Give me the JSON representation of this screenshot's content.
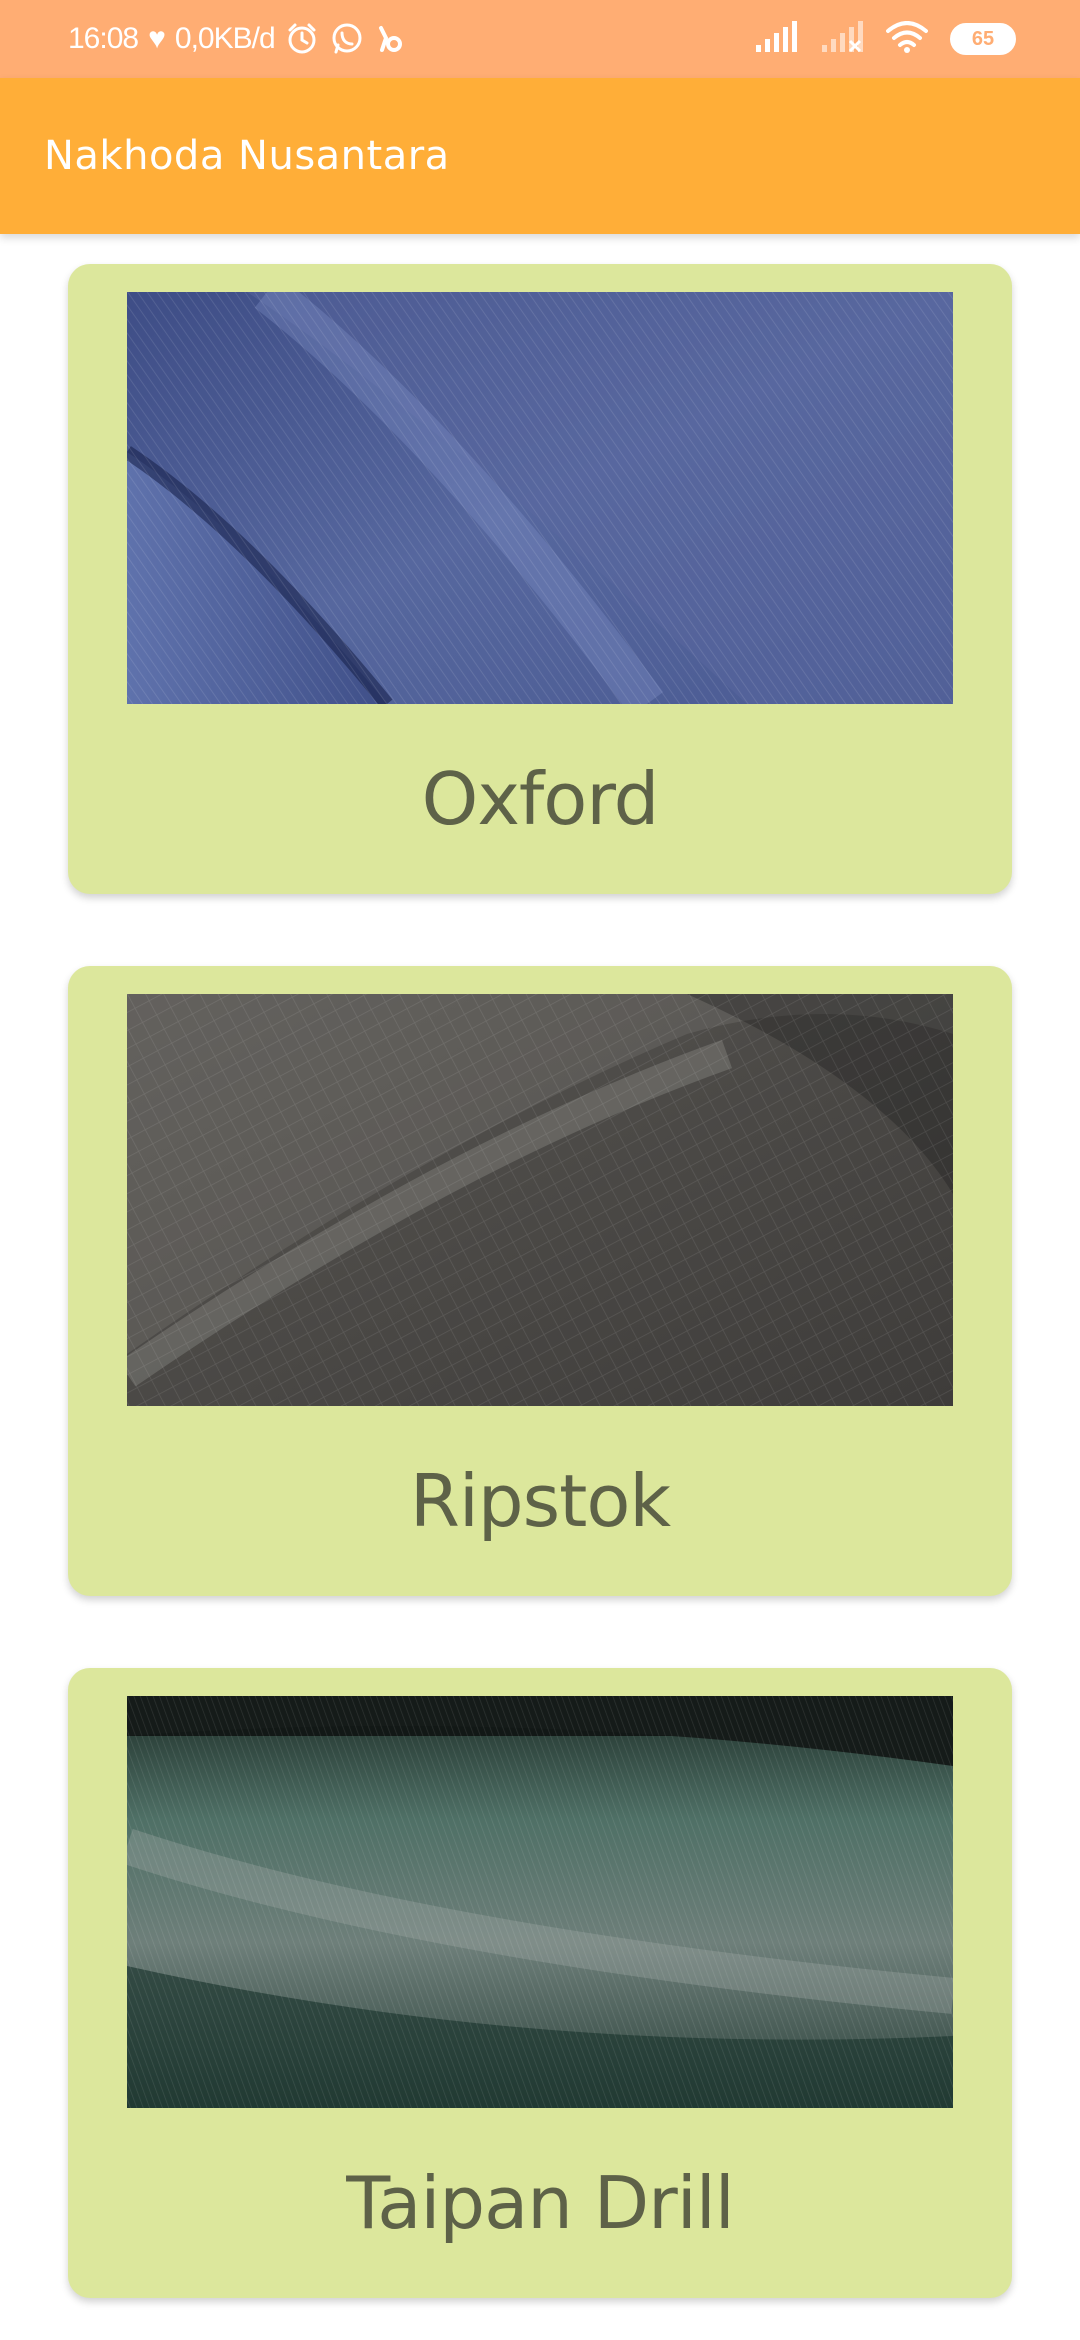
{
  "status_bar": {
    "time": "16:08",
    "heart": "♥",
    "speed": "0,0KB/d",
    "battery": "65",
    "background": "#FFAD73"
  },
  "app_bar": {
    "title": "Nakhoda Nusantara",
    "background": "#FFAE38"
  },
  "fabrics": [
    {
      "name": "Oxford",
      "image": "blue-twill-fabric-photo",
      "swatch": "#4A5A92"
    },
    {
      "name": "Ripstok",
      "image": "dark-grey-ripstop-fabric-photo",
      "swatch": "#4A4845"
    },
    {
      "name": "Taipan Drill",
      "image": "dark-green-drill-fabric-photo",
      "swatch": "#2E4A40"
    }
  ],
  "card_color": "#DCE79C",
  "label_color": "#5E6248"
}
